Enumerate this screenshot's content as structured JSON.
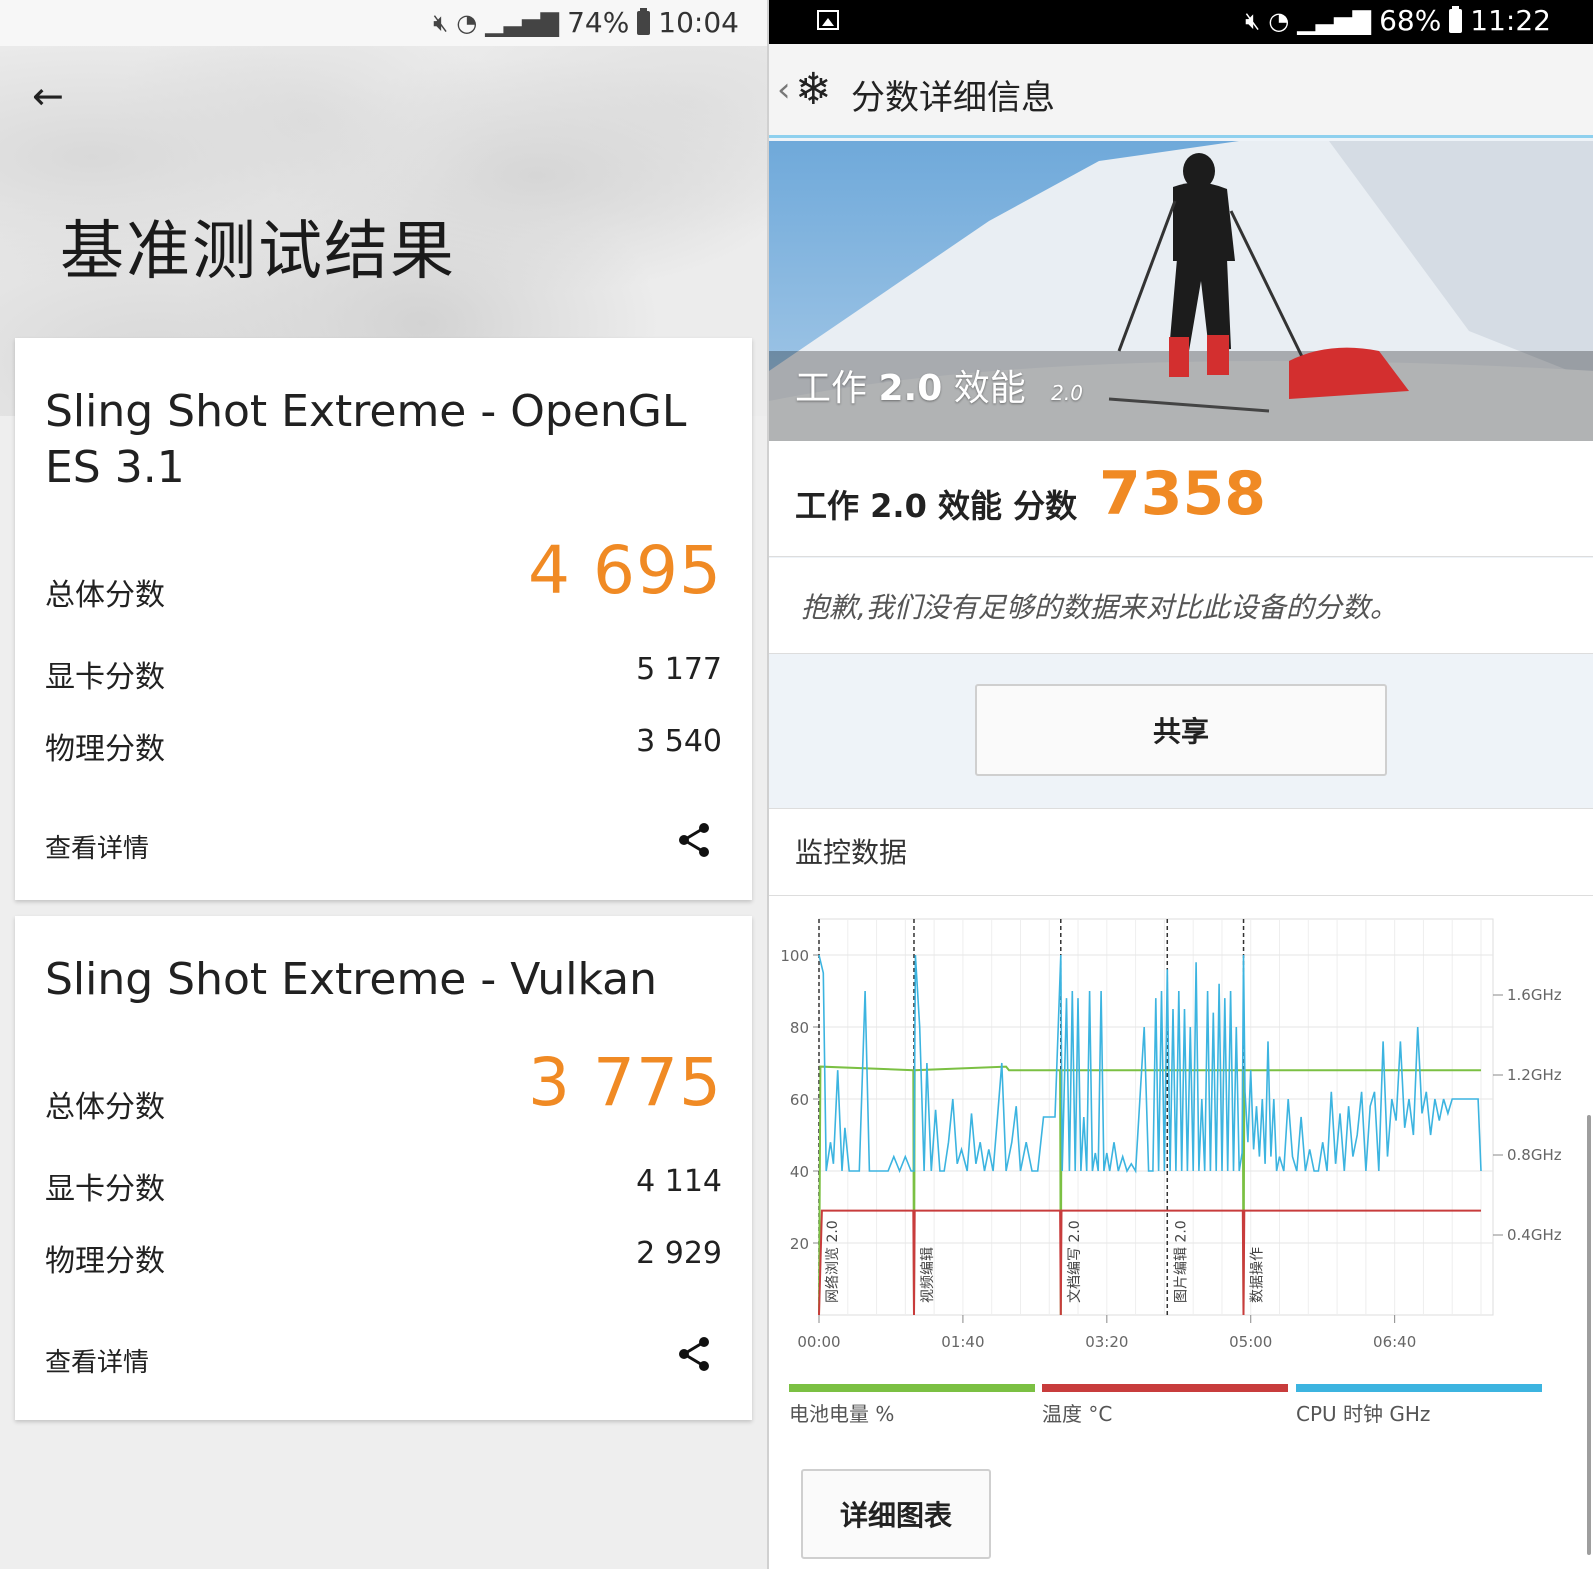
{
  "left": {
    "status": {
      "battery": "74%",
      "time": "10:04"
    },
    "title": "基准测试结果",
    "cards": [
      {
        "title": "Sling Shot Extreme - OpenGL ES 3.1",
        "overall_label": "总体分数",
        "overall": "4 695",
        "graphics_label": "显卡分数",
        "graphics": "5 177",
        "physics_label": "物理分数",
        "physics": "3 540",
        "details_label": "查看详情"
      },
      {
        "title": "Sling Shot Extreme - Vulkan",
        "overall_label": "总体分数",
        "overall": "3 775",
        "graphics_label": "显卡分数",
        "graphics": "4 114",
        "physics_label": "物理分数",
        "physics": "2 929",
        "details_label": "查看详情"
      }
    ],
    "accent_color": "#f08a24"
  },
  "right": {
    "status": {
      "battery": "68%",
      "time": "11:22"
    },
    "header_title": "分数详细信息",
    "banner": {
      "title_a": "工作",
      "title_b": "2.0",
      "title_c": "效能",
      "version": "2.0"
    },
    "score_label": "工作 2.0 效能 分数",
    "score": "7358",
    "no_data_text": "抱歉,我们没有足够的数据来对比此设备的分数。",
    "share_label": "共享",
    "monitor_title": "监控数据",
    "detail_chart_label": "详细图表",
    "legend": [
      {
        "label": "电池电量 %",
        "color": "#7bc043"
      },
      {
        "label": "温度 °C",
        "color": "#c83c3c"
      },
      {
        "label": "CPU 时钟 GHz",
        "color": "#3cb4e0"
      }
    ]
  },
  "chart_data": {
    "type": "line",
    "x_ticks": [
      "00:00",
      "01:40",
      "03:20",
      "05:00",
      "06:40"
    ],
    "x_range_seconds": [
      0,
      460
    ],
    "y_left": {
      "ticks": [
        20,
        40,
        60,
        80,
        100
      ],
      "range": [
        0,
        110
      ]
    },
    "y_right": {
      "ticks": [
        "0.4GHz",
        "0.8GHz",
        "1.2GHz",
        "1.6GHz"
      ],
      "range_ghz": [
        0,
        1.98
      ]
    },
    "grid": true,
    "section_markers": [
      {
        "t": 0,
        "label": "网络浏览 2.0"
      },
      {
        "t": 66,
        "label": "视频编辑"
      },
      {
        "t": 168,
        "label": "文档编写 2.0"
      },
      {
        "t": 242,
        "label": "图片编辑 2.0"
      },
      {
        "t": 295,
        "label": "数据操作"
      }
    ],
    "series": [
      {
        "name": "电池电量 %",
        "color": "#7bc043",
        "x": [
          0,
          1,
          130,
          132,
          460
        ],
        "y": [
          0,
          69,
          69,
          68,
          68
        ],
        "dips_to_zero_at": [
          66,
          168,
          295
        ]
      },
      {
        "name": "温度 °C",
        "color": "#c83c3c",
        "x": [
          0,
          2,
          460
        ],
        "y": [
          0,
          29,
          29
        ],
        "dips_to_zero_at": [
          66,
          168,
          295
        ]
      },
      {
        "name": "CPU 时钟 GHz",
        "color": "#3cb4e0",
        "x": [
          0,
          3,
          5,
          8,
          10,
          13,
          16,
          18,
          21,
          25,
          28,
          32,
          35,
          38,
          41,
          44,
          48,
          52,
          56,
          60,
          64,
          66,
          67,
          70,
          73,
          75,
          78,
          81,
          84,
          87,
          90,
          93,
          96,
          99,
          103,
          106,
          109,
          112,
          115,
          118,
          121,
          124,
          127,
          130,
          134,
          137,
          140,
          144,
          148,
          152,
          156,
          160,
          164,
          168,
          169,
          172,
          174,
          176,
          178,
          180,
          182,
          184,
          186,
          188,
          190,
          192,
          194,
          196,
          198,
          200,
          202,
          205,
          208,
          211,
          214,
          217,
          220,
          223,
          226,
          229,
          232,
          234,
          236,
          238,
          240,
          242,
          244,
          246,
          248,
          250,
          252,
          254,
          256,
          258,
          260,
          262,
          264,
          266,
          268,
          270,
          272,
          274,
          276,
          278,
          280,
          282,
          284,
          286,
          288,
          290,
          292,
          294,
          295,
          296,
          298,
          300,
          302,
          304,
          306,
          308,
          310,
          312,
          314,
          316,
          318,
          320,
          323,
          326,
          329,
          332,
          335,
          338,
          341,
          344,
          347,
          350,
          353,
          356,
          359,
          362,
          365,
          368,
          371,
          374,
          377,
          380,
          383,
          386,
          389,
          392,
          395,
          398,
          401,
          404,
          407,
          410,
          413,
          416,
          419,
          422,
          425,
          428,
          431,
          434,
          437,
          440,
          443,
          446,
          449,
          452,
          455,
          458,
          460
        ],
        "y": [
          100,
          95,
          40,
          48,
          42,
          68,
          40,
          52,
          40,
          40,
          40,
          90,
          40,
          40,
          40,
          40,
          40,
          44,
          40,
          44,
          40,
          40,
          100,
          80,
          40,
          70,
          40,
          57,
          40,
          40,
          48,
          60,
          42,
          46,
          40,
          56,
          42,
          48,
          40,
          46,
          40,
          55,
          70,
          40,
          48,
          58,
          40,
          48,
          40,
          40,
          55,
          55,
          55,
          100,
          40,
          88,
          40,
          90,
          40,
          88,
          40,
          55,
          40,
          90,
          40,
          45,
          40,
          90,
          40,
          45,
          40,
          48,
          40,
          44,
          40,
          42,
          40,
          60,
          80,
          40,
          40,
          88,
          40,
          90,
          40,
          96,
          40,
          85,
          40,
          90,
          40,
          85,
          40,
          80,
          40,
          98,
          40,
          60,
          40,
          90,
          40,
          84,
          40,
          92,
          40,
          88,
          40,
          90,
          40,
          80,
          40,
          45,
          100,
          62,
          48,
          68,
          46,
          58,
          44,
          60,
          42,
          76,
          44,
          60,
          40,
          44,
          40,
          60,
          44,
          40,
          55,
          40,
          46,
          40,
          40,
          48,
          40,
          62,
          42,
          56,
          40,
          58,
          44,
          50,
          62,
          40,
          58,
          62,
          40,
          76,
          44,
          60,
          54,
          76,
          52,
          60,
          50,
          80,
          56,
          62,
          50,
          60,
          54,
          60,
          56,
          60,
          60,
          60,
          60,
          60,
          60,
          60,
          40
        ]
      }
    ]
  }
}
